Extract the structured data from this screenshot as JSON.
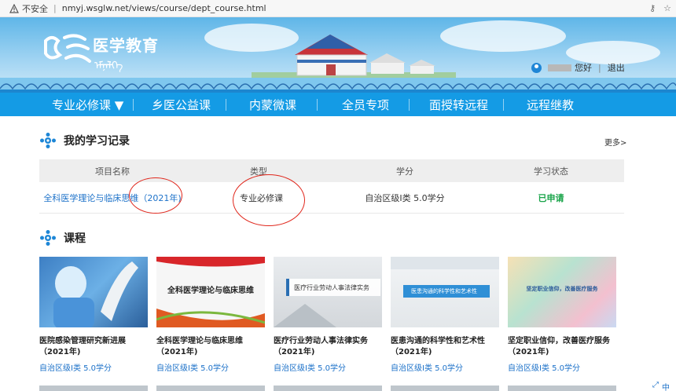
{
  "browser": {
    "security_label": "不安全",
    "url": "nmyj.wsglw.net/views/course/dept_course.html"
  },
  "header": {
    "logo_cn": "医学教育",
    "logo_mongol": "ᠡᠮᠨᠡᠯᠭᠡ",
    "greeting": "您好",
    "logout": "退出"
  },
  "nav": {
    "items": [
      {
        "label": "专业必修课 ▼"
      },
      {
        "label": "乡医公益课"
      },
      {
        "label": "内蒙微课"
      },
      {
        "label": "全员专项"
      },
      {
        "label": "面授转远程"
      },
      {
        "label": "远程继教"
      }
    ]
  },
  "records": {
    "title": "我的学习记录",
    "more": "更多>",
    "columns": [
      "项目名称",
      "类型",
      "学分",
      "学习状态"
    ],
    "rows": [
      {
        "name": "全科医学理论与临床思维（2021年)",
        "type": "专业必修课",
        "credit": "自治区级I类 5.0学分",
        "status": "已申请"
      }
    ]
  },
  "courses": {
    "title": "课程",
    "items": [
      {
        "title": "医院感染管理研究新进展（2021年)",
        "credit": "自治区级I类 5.0学分",
        "thumb_text": ""
      },
      {
        "title": "全科医学理论与临床思维（2021年)",
        "credit": "自治区级I类 5.0学分",
        "thumb_text": "全科医学理论与临床思维"
      },
      {
        "title": "医疗行业劳动人事法律实务（2021年)",
        "credit": "自治区级I类 5.0学分",
        "thumb_text": "医疗行业劳动人事法律实务"
      },
      {
        "title": "医患沟通的科学性和艺术性（2021年)",
        "credit": "自治区级I类 5.0学分",
        "thumb_text": "医患沟通的科学性和艺术性"
      },
      {
        "title": "坚定职业信仰，改善医疗服务（2021年)",
        "credit": "自治区级I类 5.0学分",
        "thumb_text": "坚定职业信仰，改善医疗服务"
      }
    ]
  },
  "footer_icons": {
    "lang": "中"
  },
  "colors": {
    "nav_blue": "#149be5",
    "link_blue": "#1d72c9",
    "status_green": "#1aa44a",
    "annotation_red": "#e0261b"
  }
}
